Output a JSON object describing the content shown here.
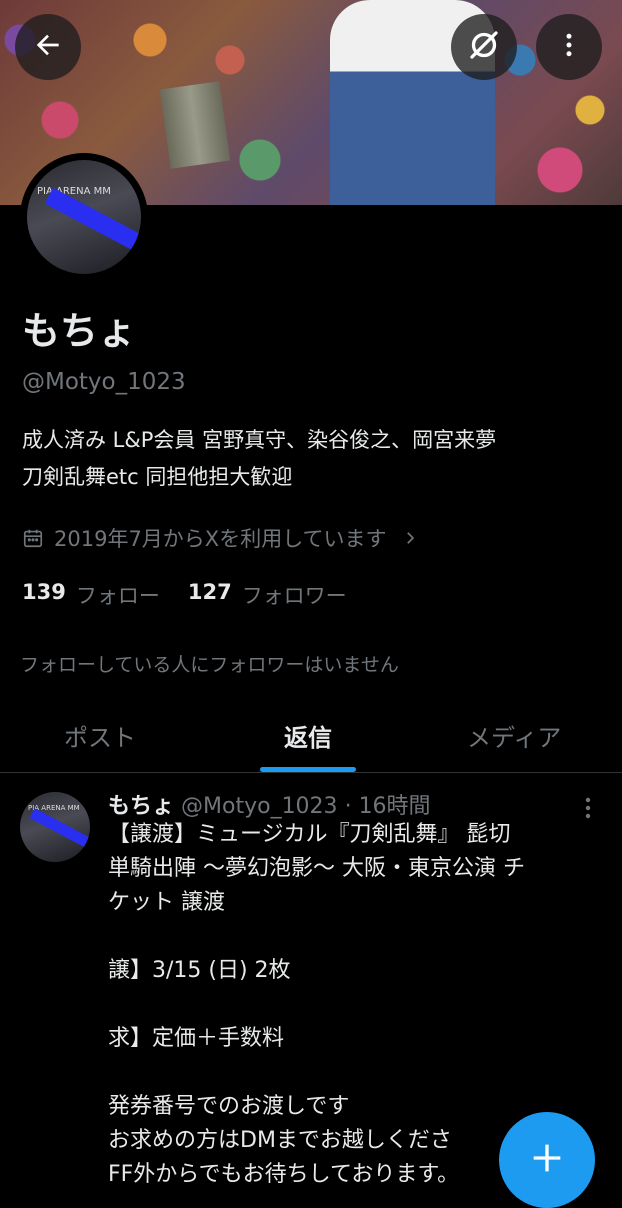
{
  "profile": {
    "avatar_sign": "PIA ARENA MM",
    "name": "もちょ",
    "handle": "@Motyo_1023",
    "bio_line1": "成人済み L&P会員 宮野真守、染谷俊之、岡宮来夢",
    "bio_line2": "刀剣乱舞etc 同担他担大歓迎",
    "joined": "2019年7月からXを利用しています",
    "following_count": "139",
    "following_label": "フォロー",
    "followers_count": "127",
    "followers_label": "フォロワー",
    "no_mutual_followers": "フォローしている人にフォロワーはいません"
  },
  "tabs": [
    {
      "label": "ポスト",
      "active": false
    },
    {
      "label": "返信",
      "active": true
    },
    {
      "label": "メディア",
      "active": false
    }
  ],
  "post": {
    "name": "もちょ",
    "handle": "@Motyo_1023",
    "separator": "·",
    "time": "16時間",
    "lines": [
      "【譲渡】ミュージカル『刀剣乱舞』 髭切",
      "単騎出陣 〜夢幻泡影〜 大阪・東京公演 チ",
      "ケット 譲渡",
      "",
      "譲】3/15 (日) 2枚",
      "",
      "求】定価＋手数料",
      "",
      "発券番号でのお渡しです",
      "お求めの方はDMまでお越しくださ",
      "FF外からでもお待ちしております。"
    ]
  },
  "colors": {
    "background": "#000000",
    "accent": "#1d9bf0",
    "text_primary": "#e7e9ea",
    "text_secondary": "#71767b"
  },
  "icons": {
    "back": "arrow-left-icon",
    "grok": "grok-icon",
    "more": "more-vertical-icon",
    "calendar": "calendar-icon",
    "chevron": "chevron-right-icon",
    "compose": "plus-icon"
  }
}
